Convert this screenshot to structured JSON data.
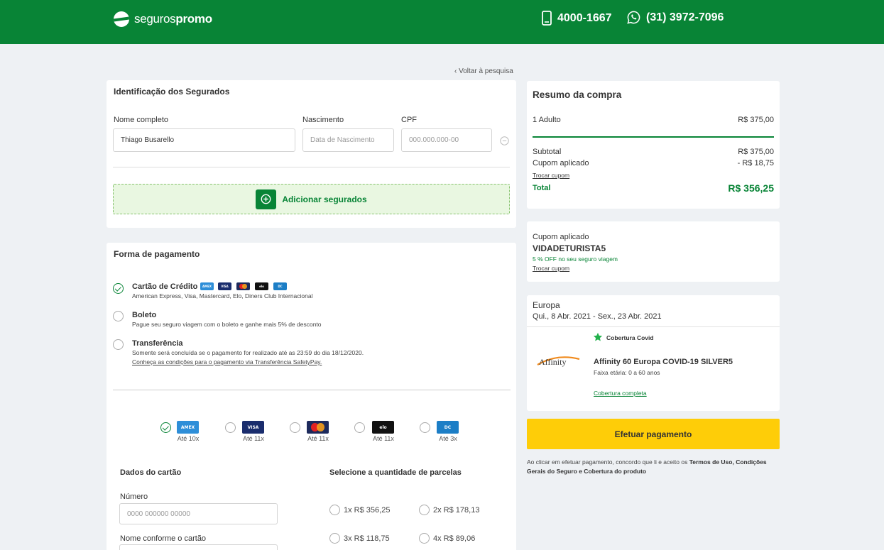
{
  "header": {
    "logo_light": "seguros",
    "logo_bold": "promo",
    "phone": "4000-1667",
    "whatsapp": "(31) 3972-7096"
  },
  "back_link": "‹ Voltar à pesquisa",
  "identification": {
    "title": "Identificação dos Segurados",
    "name_label": "Nome completo",
    "name_value": "Thiago Busarello",
    "birth_label": "Nascimento",
    "birth_placeholder": "Data de Nascimento",
    "cpf_label": "CPF",
    "cpf_placeholder": "000.000.000-00",
    "add_button": "Adicionar segurados"
  },
  "payment": {
    "title": "Forma de pagamento",
    "methods": [
      {
        "title": "Cartão de Crédito",
        "desc": "American Express, Visa, Mastercard, Elo, Diners Club Internacional",
        "selected": true
      },
      {
        "title": "Boleto",
        "desc": "Pague seu seguro viagem com o boleto e ganhe mais 5% de desconto",
        "selected": false
      },
      {
        "title": "Transferência",
        "desc": "Somente será concluída se o pagamento for realizado até as 23:59 do dia 18/12/2020.",
        "link": "Conheça as condições para o pagamento via Transferência SafetyPay.",
        "selected": false
      }
    ],
    "brands": [
      {
        "name": "amex",
        "short": "AMEX",
        "installments": "Até 10x",
        "selected": true
      },
      {
        "name": "visa",
        "short": "VISA",
        "installments": "Até 11x",
        "selected": false
      },
      {
        "name": "mastercard",
        "short": "",
        "installments": "Até 11x",
        "selected": false
      },
      {
        "name": "elo",
        "short": "elo",
        "installments": "Até 11x",
        "selected": false
      },
      {
        "name": "diners",
        "short": "DINERS",
        "installments": "Até 3x",
        "selected": false
      }
    ],
    "card_section_title": "Dados do cartão",
    "number_label": "Número",
    "number_placeholder": "0000 000000 00000",
    "holder_label": "Nome conforme o cartão",
    "installments_title": "Selecione a quantidade de parcelas",
    "installments": [
      "1x R$ 356,25",
      "2x R$ 178,13",
      "3x R$ 118,75",
      "4x R$ 89,06"
    ]
  },
  "summary": {
    "title": "Resumo da compra",
    "adults_label": "1 Adulto",
    "adults_value": "R$ 375,00",
    "subtotal_label": "Subtotal",
    "subtotal_value": "R$ 375,00",
    "coupon_label": "Cupom aplicado",
    "coupon_value": "- R$ 18,75",
    "change_coupon": "Trocar cupom",
    "total_label": "Total",
    "total_value": "R$ 356,25"
  },
  "coupon": {
    "label": "Cupom aplicado",
    "code": "VIDADETURISTA5",
    "desc": "5 % OFF no seu seguro viagem",
    "change": "Trocar cupom"
  },
  "trip": {
    "destination": "Europa",
    "dates": "Qui., 8 Abr. 2021 - Sex., 23 Abr. 2021",
    "covid": "Cobertura Covid",
    "insurer_logo": "Affinity",
    "plan": "Affinity 60 Europa COVID-19 SILVER5",
    "age_range": "Faixa etária: 0 a 60 anos",
    "coverage_link": "Cobertura completa"
  },
  "pay_button": "Efetuar pagamento",
  "terms": {
    "prefix": "Ao clicar em efetuar pagamento, concordo que li e aceito os ",
    "terms_link": "Termos de Uso,",
    "conditions_link": "Condições Gerais do Seguro e Cobertura do produto"
  },
  "colors": {
    "primary": "#088436",
    "accent": "#fecd08",
    "background": "#eef1f4"
  }
}
